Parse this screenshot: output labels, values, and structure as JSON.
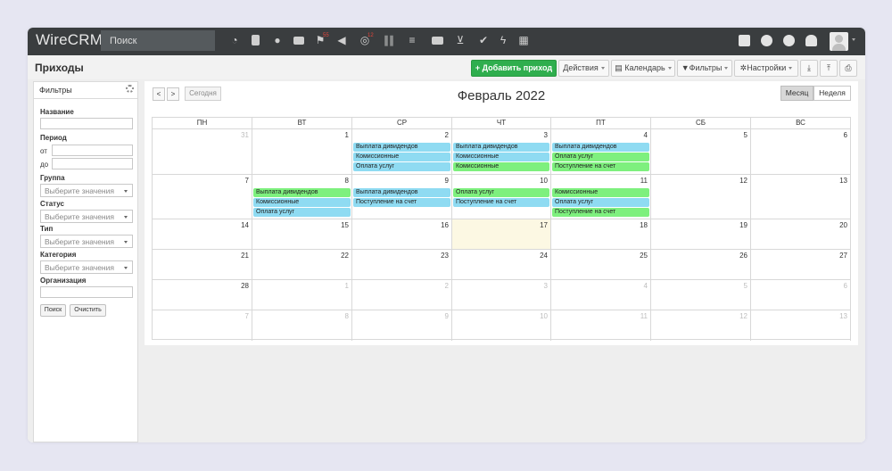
{
  "app": {
    "logo": "WireCRM",
    "search_placeholder": "Поиск",
    "badges": {
      "flag": "55",
      "help": "12"
    }
  },
  "page": {
    "title": "Приходы"
  },
  "toolbar": {
    "add_income": "+ Добавить приход",
    "actions": "Действия",
    "calendar": "Календарь",
    "filters": "Фильтры",
    "settings": "Настройки"
  },
  "sidebar": {
    "header": "Фильтры",
    "name_label": "Название",
    "period_label": "Период",
    "from_label": "от",
    "to_label": "до",
    "group_label": "Группа",
    "status_label": "Статус",
    "type_label": "Тип",
    "category_label": "Категория",
    "org_label": "Организация",
    "select_placeholder": "Выберите значения",
    "search_btn": "Поиск",
    "clear_btn": "Очистить"
  },
  "calendar": {
    "title": "Февраль 2022",
    "prev": "<",
    "next": ">",
    "today": "Сегодня",
    "view_month": "Месяц",
    "view_week": "Неделя",
    "dows": [
      "ПН",
      "ВТ",
      "СР",
      "ЧТ",
      "ПТ",
      "СБ",
      "ВС"
    ],
    "weeks": [
      [
        "31",
        "1",
        "2",
        "3",
        "4",
        "5",
        "6"
      ],
      [
        "7",
        "8",
        "9",
        "10",
        "11",
        "12",
        "13"
      ],
      [
        "14",
        "15",
        "16",
        "17",
        "18",
        "19",
        "20"
      ],
      [
        "21",
        "22",
        "23",
        "24",
        "25",
        "26",
        "27"
      ],
      [
        "28",
        "1",
        "2",
        "3",
        "4",
        "5",
        "6"
      ],
      [
        "7",
        "8",
        "9",
        "10",
        "11",
        "12",
        "13"
      ]
    ],
    "events": {
      "w0": [
        [],
        [],
        [
          {
            "t": "Выплата дивидендов",
            "c": "blue"
          },
          {
            "t": "Комиссионные",
            "c": "blue"
          },
          {
            "t": "Оплата услуг",
            "c": "blue"
          }
        ],
        [
          {
            "t": "Выплата дивидендов",
            "c": "blue"
          },
          {
            "t": "Комиссионные",
            "c": "blue"
          },
          {
            "t": "Комиссионные",
            "c": "green"
          }
        ],
        [
          {
            "t": "Выплата дивидендов",
            "c": "blue"
          },
          {
            "t": "Оплата услуг",
            "c": "green"
          },
          {
            "t": "Поступление на счет",
            "c": "green"
          }
        ],
        [],
        []
      ],
      "w1": [
        [],
        [
          {
            "t": "Выплата дивидендов",
            "c": "green"
          },
          {
            "t": "Комиссионные",
            "c": "blue"
          },
          {
            "t": "Оплата услуг",
            "c": "blue"
          }
        ],
        [
          {
            "t": "Выплата дивидендов",
            "c": "blue"
          },
          {
            "t": "Поступление на счет",
            "c": "blue"
          }
        ],
        [
          {
            "t": "Оплата услуг",
            "c": "green"
          },
          {
            "t": "Поступление на счет",
            "c": "blue"
          }
        ],
        [
          {
            "t": "Комиссионные",
            "c": "green"
          },
          {
            "t": "Оплата услуг",
            "c": "blue"
          },
          {
            "t": "Поступление на счет",
            "c": "green"
          }
        ],
        [],
        []
      ]
    },
    "colors": {
      "blue": "#8fdbf2",
      "green": "#7ef07e",
      "today": "#fcf8e3"
    }
  }
}
